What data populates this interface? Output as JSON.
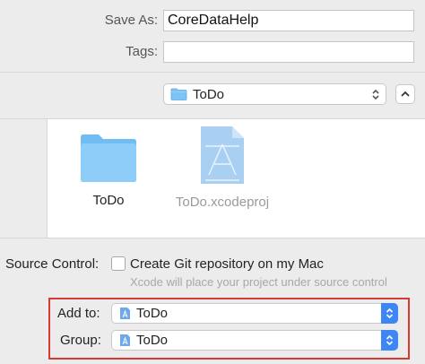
{
  "save_as": {
    "label": "Save As:",
    "value": "CoreDataHelp"
  },
  "tags": {
    "label": "Tags:",
    "value": ""
  },
  "location": {
    "selected": "ToDo",
    "folder_icon": "folder-icon",
    "expand_icon": "chevron-up-icon"
  },
  "browser": {
    "items": [
      {
        "name": "ToDo",
        "icon": "folder-icon",
        "dimmed": false
      },
      {
        "name": "ToDo.xcodeproj",
        "icon": "xcodeproj-icon",
        "dimmed": true
      }
    ]
  },
  "source_control": {
    "label": "Source Control:",
    "checkbox_label": "Create Git repository on my Mac",
    "checked": false,
    "hint": "Xcode will place your project under source control"
  },
  "add_to": {
    "label": "Add to:",
    "value": "ToDo"
  },
  "group": {
    "label": "Group:",
    "value": "ToDo"
  },
  "colors": {
    "accent": "#3d86f4",
    "highlight": "#d63a34",
    "folder": "#7ec3f5"
  }
}
